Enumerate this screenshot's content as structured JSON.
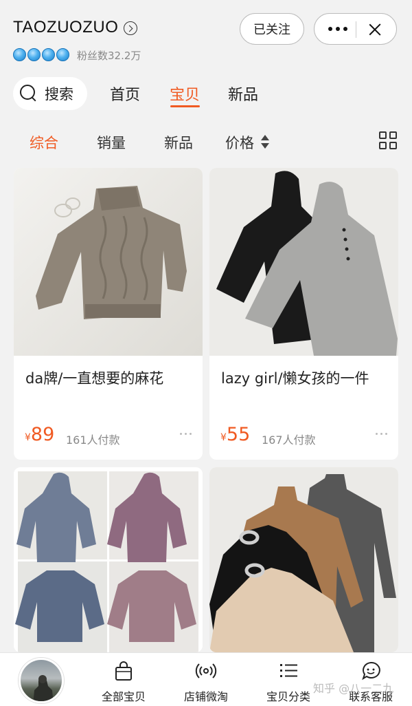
{
  "header": {
    "shop_name": "TAOZUOZUO",
    "fans": "粉丝数32.2万",
    "follow_label": "已关注"
  },
  "nav": {
    "search_label": "搜索",
    "tabs": [
      {
        "label": "首页",
        "active": false
      },
      {
        "label": "宝贝",
        "active": true
      },
      {
        "label": "新品",
        "active": false
      }
    ]
  },
  "sort": {
    "options": [
      {
        "label": "综合",
        "active": true
      },
      {
        "label": "销量",
        "active": false
      },
      {
        "label": "新品",
        "active": false
      },
      {
        "label": "价格",
        "active": false
      }
    ]
  },
  "products": [
    {
      "title": "da牌/一直想要的麻花",
      "currency": "¥",
      "price": "89",
      "sales": "161人付款"
    },
    {
      "title": "lazy girl/懒女孩的一件",
      "currency": "¥",
      "price": "55",
      "sales": "167人付款"
    },
    {
      "title": "",
      "currency": "",
      "price": "",
      "sales": ""
    },
    {
      "title": "",
      "currency": "",
      "price": "",
      "sales": ""
    }
  ],
  "bottom_bar": {
    "items": [
      {
        "label": "全部宝贝",
        "icon": "shopping-bag-icon"
      },
      {
        "label": "店铺微淘",
        "icon": "broadcast-icon"
      },
      {
        "label": "宝贝分类",
        "icon": "list-icon"
      },
      {
        "label": "联系客服",
        "icon": "chat-bubble-icon"
      }
    ]
  },
  "watermark": "知乎 @八一二九",
  "colors": {
    "accent": "#f05a22",
    "background": "#f2f2f2"
  }
}
